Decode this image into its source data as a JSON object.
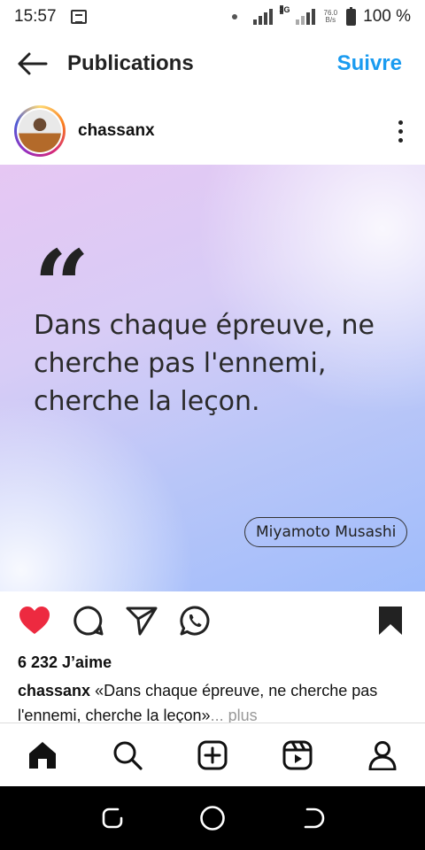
{
  "status_bar": {
    "time": "15:57",
    "network_tag": "3G",
    "speed_value": "76.0",
    "speed_unit": "B/s",
    "battery_text": "100 %"
  },
  "header": {
    "title": "Publications",
    "follow_label": "Suivre"
  },
  "post": {
    "username": "chassanx",
    "image": {
      "quote_mark": "“",
      "quote_lines": [
        "Dans chaque épreuve, ne",
        "cherche pas l'ennemi,",
        "cherche la leçon."
      ],
      "author": "Miyamoto Musashi"
    },
    "liked": true,
    "likes_text": "6 232 J’aime",
    "caption_user": "chassanx",
    "caption_text": " «Dans chaque épreuve, ne cherche pas l'ennemi, cherche la leçon»",
    "caption_more": "... plus"
  },
  "icons": {
    "back": "arrow-left-icon",
    "like": "heart-icon",
    "comment": "comment-icon",
    "share": "paper-plane-icon",
    "whatsapp": "whatsapp-icon",
    "save": "bookmark-icon",
    "home": "home-icon",
    "search": "search-icon",
    "create": "plus-square-icon",
    "reels": "reels-icon",
    "profile": "profile-icon"
  },
  "colors": {
    "accent": "#1a9bf0",
    "like_red": "#ed2a40",
    "text": "#111111"
  }
}
